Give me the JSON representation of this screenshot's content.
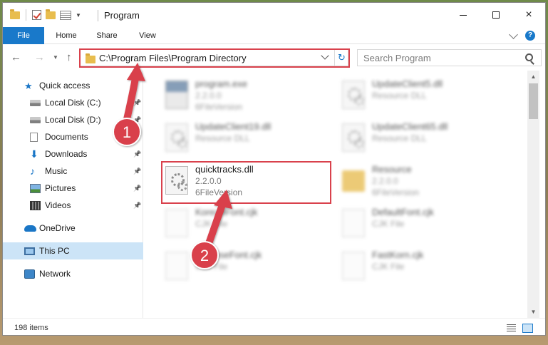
{
  "window": {
    "title": "Program",
    "minimize": "minimize",
    "maximize": "maximize",
    "close": "×"
  },
  "ribbon": {
    "tabs": [
      "File",
      "Home",
      "Share",
      "View"
    ],
    "help": "?"
  },
  "address": {
    "path": "C:\\Program Files\\Program Directory"
  },
  "search": {
    "placeholder": "Search Program"
  },
  "sidebar": {
    "items": [
      {
        "label": "Quick access",
        "icon": "star-icon"
      },
      {
        "label": "Local Disk (C:)",
        "icon": "disk-icon",
        "pinned": true
      },
      {
        "label": "Local Disk (D:)",
        "icon": "disk-icon",
        "pinned": true
      },
      {
        "label": "Documents",
        "icon": "document-icon",
        "pinned": true
      },
      {
        "label": "Downloads",
        "icon": "download-icon",
        "pinned": true
      },
      {
        "label": "Music",
        "icon": "music-icon",
        "pinned": true
      },
      {
        "label": "Pictures",
        "icon": "picture-icon",
        "pinned": true
      },
      {
        "label": "Videos",
        "icon": "video-icon",
        "pinned": true
      },
      {
        "label": "OneDrive",
        "icon": "cloud-icon"
      },
      {
        "label": "This PC",
        "icon": "computer-icon",
        "selected": true
      },
      {
        "label": "Network",
        "icon": "network-icon"
      }
    ]
  },
  "files": [
    {
      "name": "program.exe",
      "line2": "2.2.0.0",
      "line3": "6FileVersion",
      "icon": "exe-icon",
      "blurred": true
    },
    {
      "name": "UpdateClient5.dll",
      "line2": "Resource DLL",
      "line3": "",
      "icon": "dll-icon",
      "blurred": true
    },
    {
      "name": "UpdateClient19.dll",
      "line2": "Resource DLL",
      "line3": "",
      "icon": "dll-icon",
      "blurred": true
    },
    {
      "name": "UpdateClient65.dll",
      "line2": "Resource DLL",
      "line3": "",
      "icon": "dll-icon",
      "blurred": true
    },
    {
      "name": "quicktracks.dll",
      "line2": "2.2.0.0",
      "line3": "6FileVersion",
      "icon": "dll-icon",
      "blurred": false
    },
    {
      "name": "Resource",
      "line2": "2.2.0.0",
      "line3": "6FileVersion",
      "icon": "folder-icon",
      "blurred": true
    },
    {
      "name": "KoreanFont.cjk",
      "line2": "CJK File",
      "line3": "",
      "icon": "blank-file-icon",
      "blurred": true
    },
    {
      "name": "DefaultFont.cjk",
      "line2": "CJK File",
      "line3": "",
      "icon": "blank-file-icon",
      "blurred": true
    },
    {
      "name": "ChineseFont.cjk",
      "line2": "CJK File",
      "line3": "",
      "icon": "blank-file-icon",
      "blurred": true
    },
    {
      "name": "FastKorn.cjk",
      "line2": "CJK File",
      "line3": "",
      "icon": "blank-file-icon",
      "blurred": true
    }
  ],
  "status": {
    "item_count": "198 items"
  },
  "annotations": {
    "step1": "1",
    "step2": "2"
  },
  "colors": {
    "accent": "#1979ca",
    "highlight": "#d9414c",
    "selected": "#cce4f7"
  }
}
